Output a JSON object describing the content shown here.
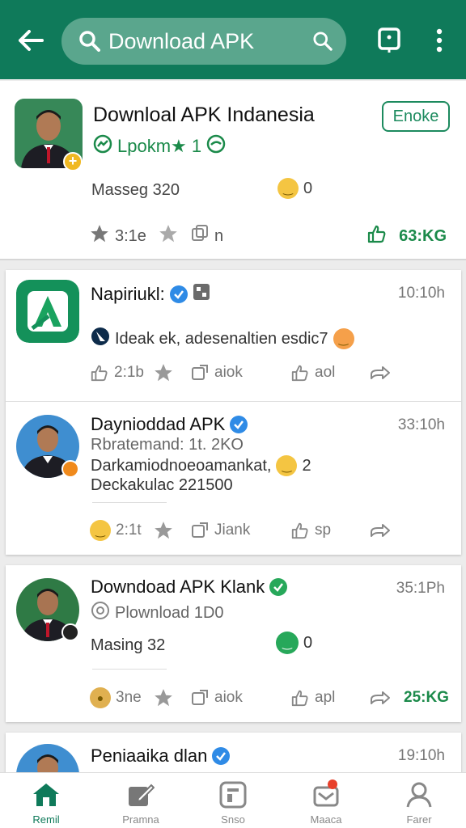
{
  "topbar": {
    "search_value": "Download APK",
    "icons": [
      "back-arrow-icon",
      "search-icon",
      "search-icon",
      "bookmark-icon",
      "more-vert-icon"
    ],
    "color": "#0f7a5a"
  },
  "feature": {
    "title": "Downloal APK Indanesia",
    "subtitle": "Lpokm★ 1",
    "button_label": "Enoke",
    "meta": "Masseg 320",
    "emoji_count": "0",
    "rating": "3:1e",
    "tag": "n",
    "count": "63:KG"
  },
  "posts": [
    {
      "name": "Napiriukl:",
      "time": "10:10h",
      "line1": "Ideak ek, adesenaltien esdic7",
      "actions": [
        "2:1b",
        "aiok",
        "aol"
      ]
    },
    {
      "name": "Daynioddad APK",
      "time": "33:10h",
      "line1": "Rbratemand: 1t. 2KO",
      "line2": "Darkamiodnoeoamankat,",
      "line2_count": "2",
      "line3": "Deckakulac 221500",
      "actions": [
        "2:1t",
        "Jiank",
        "sp"
      ]
    },
    {
      "name": "Downdoad APK Klank",
      "time": "35:1Ph",
      "line1": "Plownload 1D0",
      "meta": "Masing 32",
      "emoji_count": "0",
      "actions": [
        "3ne",
        "aiok",
        "apl"
      ],
      "count": "25:KG"
    },
    {
      "name": "Peniaaika dlan",
      "time": "19:10h"
    }
  ],
  "bottomnav": [
    {
      "label": "Remil",
      "icon": "home-icon",
      "active": true
    },
    {
      "label": "Pramna",
      "icon": "edit-icon",
      "active": false
    },
    {
      "label": "Snso",
      "icon": "media-icon",
      "active": false
    },
    {
      "label": "Maaca",
      "icon": "inbox-icon",
      "active": false
    },
    {
      "label": "Farer",
      "icon": "profile-icon",
      "active": false
    }
  ],
  "colors": {
    "primary": "#0f7a5a",
    "accent_green": "#1b8a4a",
    "verified_blue": "#2f8be6"
  }
}
